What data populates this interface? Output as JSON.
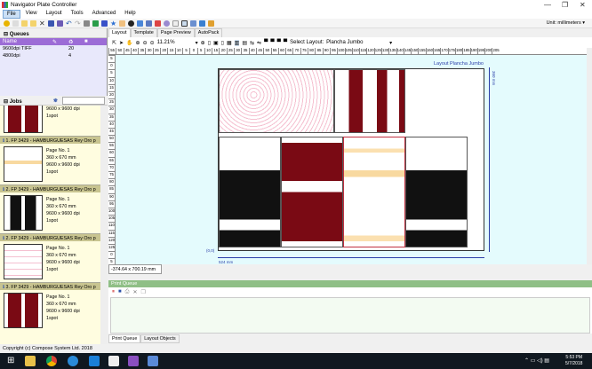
{
  "window": {
    "title": "Navigator Plate Controller",
    "minimize": "—",
    "restore": "❐",
    "close": "✕"
  },
  "menu": [
    "File",
    "View",
    "Layout",
    "Tools",
    "Advanced",
    "Help"
  ],
  "unit": {
    "label": "Unit:",
    "value": "millimeters"
  },
  "queues": {
    "title": "Queues",
    "columns": [
      "Name"
    ],
    "rows": [
      {
        "name": "9600dpi TIFF",
        "count": "20"
      },
      {
        "name": "4800dpi",
        "count": "4"
      }
    ]
  },
  "jobs": {
    "title": "Jobs",
    "items": [
      {
        "header": "",
        "info": [
          "360 x 670 mm",
          "9600 x 9600 dpi",
          "1spot"
        ],
        "thumb": "maroon"
      },
      {
        "header": "1. FP 3429 - HAMBURGUESAS Rey Oro p",
        "info": [
          "Page No. 1",
          "360 x 670 mm",
          "9600 x 9600 dpi",
          "1spot"
        ],
        "thumb": "orange"
      },
      {
        "header": "2. FP 3429 - HAMBURGUESAS Rey Oro p",
        "info": [
          "Page No. 1",
          "360 x 670 mm",
          "9600 x 9600 dpi",
          "1spot"
        ],
        "thumb": "black"
      },
      {
        "header": "2. FP 3429 - HAMBURGUESAS Rey Oro p",
        "info": [
          "Page No. 1",
          "360 x 670 mm",
          "9600 x 9600 dpi",
          "1spot"
        ],
        "thumb": "pink"
      },
      {
        "header": "3. FP 3429 - HAMBURGUESAS Rey Oro p",
        "info": [
          "Page No. 1",
          "360 x 670 mm",
          "9600 x 9600 dpi",
          "1spot"
        ],
        "thumb": "maroon"
      }
    ]
  },
  "tabs": [
    "Layout",
    "Template",
    "Page Preview",
    "AutoPack"
  ],
  "layout_toolbar": {
    "zoom": "11.21%",
    "select_layout_label": "Select Layout:",
    "select_layout_value": "Plancha Jumbo"
  },
  "ruler_h": [
    "55",
    "50",
    "45",
    "40",
    "35",
    "30",
    "25",
    "20",
    "15",
    "10",
    "5",
    "0",
    "5",
    "10",
    "15",
    "20",
    "25",
    "30",
    "35",
    "40",
    "45",
    "50",
    "55",
    "60",
    "65",
    "70",
    "75",
    "80",
    "85",
    "90",
    "95",
    "100",
    "105",
    "110",
    "115",
    "120",
    "125",
    "130",
    "135",
    "140",
    "145",
    "150",
    "155",
    "160",
    "165",
    "170",
    "175",
    "180",
    "185",
    "190",
    "195",
    "200",
    "205"
  ],
  "ruler_v": [
    "5",
    "0",
    "5",
    "10",
    "15",
    "20",
    "25",
    "30",
    "35",
    "40",
    "45",
    "50",
    "55",
    "60",
    "65",
    "70",
    "75",
    "80",
    "85",
    "90",
    "95",
    "100",
    "105",
    "110",
    "115",
    "120",
    "125",
    "0",
    "5"
  ],
  "canvas": {
    "layout_label": "Layout Plancha Jumbo",
    "width_label": "524 mm",
    "height_label": "360 mm",
    "origin": "(0,0)"
  },
  "dimension": "-374.64 x 700.19 mm",
  "print_queue": {
    "title": "Print Queue"
  },
  "bottom_tabs": [
    "Print Queue",
    "Layout Objects"
  ],
  "copyright": "Copyright (c) Compose System Ltd. 2018",
  "clock": {
    "time": "5:53 PM",
    "date": "5/7/2018"
  },
  "colors": {
    "accent_purple": "#9c6cd6",
    "print_queue_green": "#8fbf86",
    "canvas": "#e4fbfd",
    "maroon": "#7a0a14"
  }
}
